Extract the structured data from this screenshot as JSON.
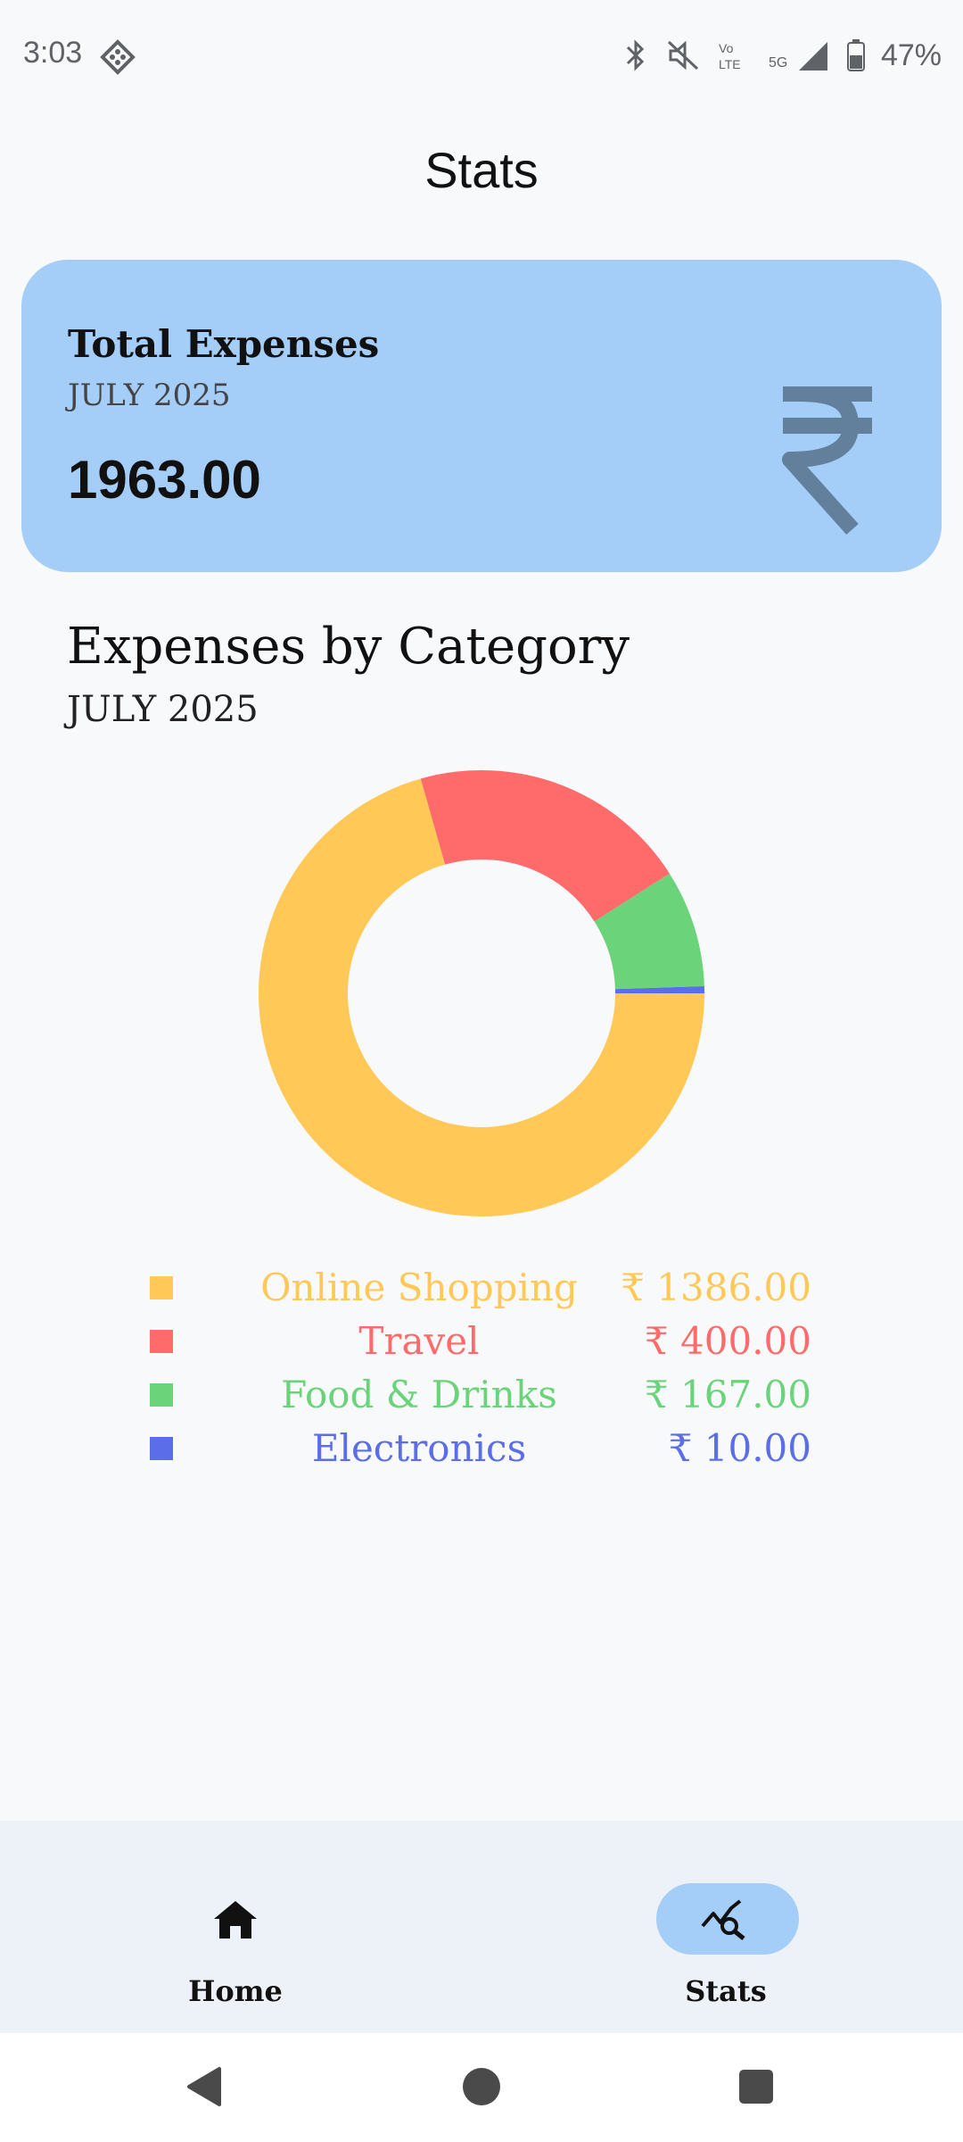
{
  "status": {
    "time": "3:03",
    "battery": "47%",
    "network": "5G",
    "icons": [
      "bluetooth-icon",
      "mute-icon",
      "volte-icon",
      "signal-icon",
      "battery-icon"
    ]
  },
  "page": {
    "title": "Stats"
  },
  "summary": {
    "title": "Total Expenses",
    "month": "JULY 2025",
    "amount": "1963.00",
    "icon": "rupee-icon"
  },
  "section": {
    "title": "Expenses by Category",
    "month": "JULY 2025"
  },
  "legend": [
    {
      "name": "Online Shopping",
      "value": "₹ 1386.00",
      "color": "#ffc857"
    },
    {
      "name": "Travel",
      "value": "₹ 400.00",
      "color": "#ff6b6b"
    },
    {
      "name": "Food & Drinks",
      "value": "₹ 167.00",
      "color": "#6bd47a"
    },
    {
      "name": "Electronics",
      "value": "₹ 10.00",
      "color": "#5b6ee8"
    }
  ],
  "chart_data": {
    "type": "pie",
    "donut": true,
    "categories": [
      "Online Shopping",
      "Travel",
      "Food & Drinks",
      "Electronics"
    ],
    "values": [
      1386,
      400,
      167,
      10
    ],
    "colors": [
      "#ffc857",
      "#ff6b6b",
      "#6bd47a",
      "#5b6ee8"
    ]
  },
  "bottom_nav": {
    "items": [
      {
        "label": "Home",
        "icon": "home-icon",
        "active": false
      },
      {
        "label": "Stats",
        "icon": "stats-search-icon",
        "active": true
      }
    ]
  },
  "system_nav": {
    "buttons": [
      "back-icon",
      "home-circle-icon",
      "recents-icon"
    ]
  }
}
